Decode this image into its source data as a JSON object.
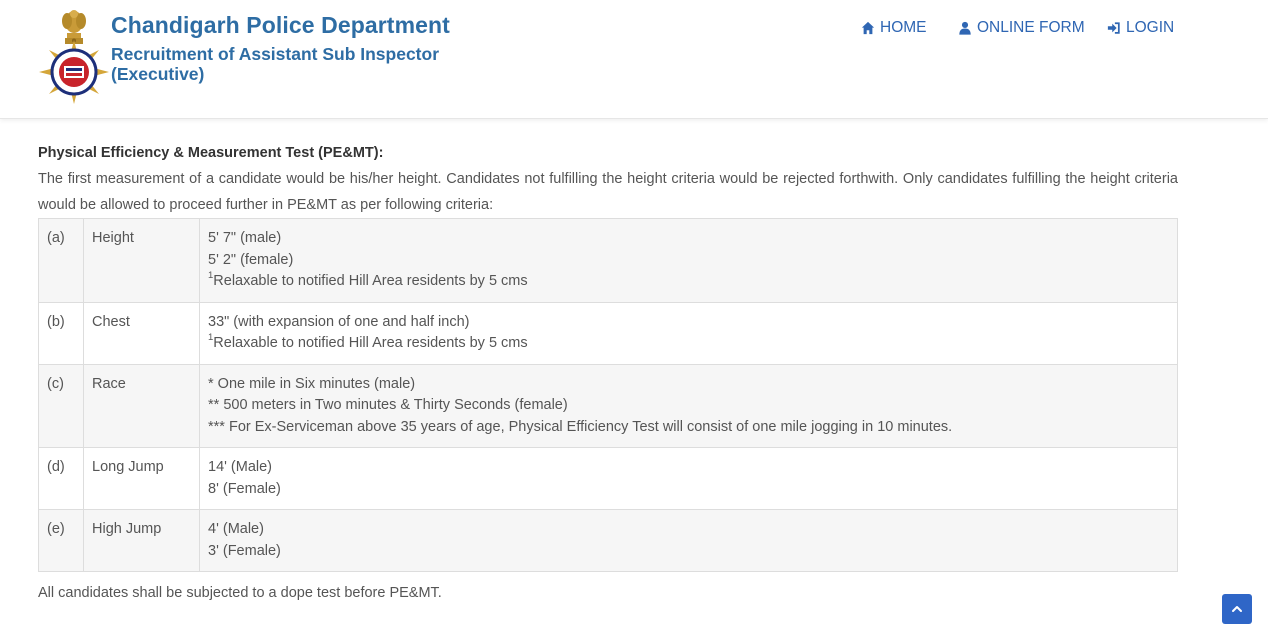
{
  "header": {
    "title": "Chandigarh Police Department",
    "subtitle": "Recruitment of Assistant Sub Inspector (Executive)",
    "brand_color": "#2e6da4",
    "logo_icons": [
      "national-emblem-icon",
      "police-badge-icon"
    ]
  },
  "nav": [
    {
      "label": "HOME",
      "icon": "home-icon"
    },
    {
      "label": "ONLINE FORM",
      "icon": "user-icon"
    },
    {
      "label": "LOGIN",
      "icon": "sign-in-icon"
    }
  ],
  "main": {
    "section_title": "Physical Efficiency & Measurement Test (PE&MT):",
    "intro": "The first measurement of a candidate would be his/her height. Candidates not fulfilling the height criteria would be rejected forthwith. Only candidates fulfilling the height criteria would be allowed to proceed further in PE&MT as per following criteria:",
    "criteria": [
      {
        "id": "(a)",
        "name": "Height",
        "details": [
          "5' 7\" (male)",
          "5' 2\" (female)"
        ],
        "note_mark": "1",
        "note": "Relaxable to notified Hill Area residents by 5 cms"
      },
      {
        "id": "(b)",
        "name": "Chest",
        "details": [
          "33\" (with expansion of one and half inch)"
        ],
        "note_mark": "1",
        "note": "Relaxable to notified Hill Area residents by 5 cms"
      },
      {
        "id": "(c)",
        "name": "Race",
        "details": [
          "* One mile in Six minutes (male)",
          "** 500 meters in Two minutes & Thirty Seconds (female)",
          "*** For Ex-Serviceman above 35 years of age, Physical Efficiency Test will consist of one mile jogging in 10 minutes."
        ]
      },
      {
        "id": "(d)",
        "name": "Long Jump",
        "details": [
          "14' (Male)",
          "8' (Female)"
        ]
      },
      {
        "id": "(e)",
        "name": "High Jump",
        "details": [
          "4' (Male)",
          "3' (Female)"
        ]
      }
    ],
    "footer_note": "All candidates shall be subjected to a dope test before PE&MT."
  },
  "scroll_top": {
    "icon": "chevron-up-icon",
    "color": "#2f66c7"
  }
}
